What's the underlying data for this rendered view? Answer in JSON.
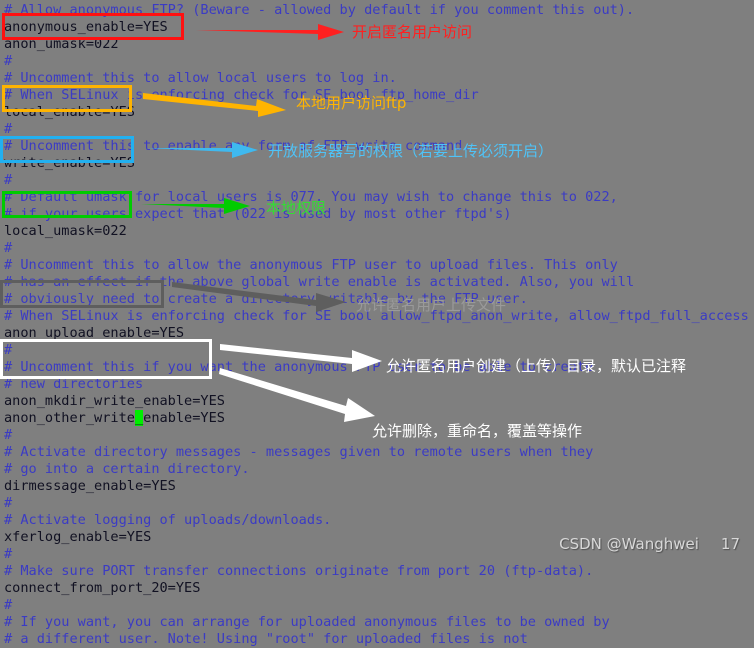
{
  "terminal": {
    "background_color": "#7f7f7f",
    "comment_color": "#3b3bc4",
    "config_color": "#111122",
    "cursor_color": "#00ee00",
    "lines": [
      {
        "t": "# Allow anonymous FTP? (Beware - allowed by default if you comment this out).",
        "k": "comment"
      },
      {
        "t": "anonymous_enable=YES",
        "k": "cfg"
      },
      {
        "t": "anon_umask=022",
        "k": "cfg"
      },
      {
        "t": "#",
        "k": "comment"
      },
      {
        "t": "# Uncomment this to allow local users to log in.",
        "k": "comment"
      },
      {
        "t": "# When SELinux is enforcing check for SE bool ftp_home_dir",
        "k": "comment"
      },
      {
        "t": "local_enable=YES",
        "k": "cfg"
      },
      {
        "t": "#",
        "k": "comment"
      },
      {
        "t": "# Uncomment this to enable any form of FTP write command.",
        "k": "comment"
      },
      {
        "t": "write_enable=YES",
        "k": "cfg"
      },
      {
        "t": "#",
        "k": "comment"
      },
      {
        "t": "# Default umask for local users is 077. You may wish to change this to 022,",
        "k": "comment"
      },
      {
        "t": "# if your users expect that (022 is used by most other ftpd's)",
        "k": "comment"
      },
      {
        "t": "local_umask=022",
        "k": "cfg"
      },
      {
        "t": "#",
        "k": "comment"
      },
      {
        "t": "# Uncomment this to allow the anonymous FTP user to upload files. This only",
        "k": "comment"
      },
      {
        "t": "# has an effect if the above global write enable is activated. Also, you will",
        "k": "comment"
      },
      {
        "t": "# obviously need to create a directory writable by the FTP user.",
        "k": "comment"
      },
      {
        "t": "# When SELinux is enforcing check for SE bool allow_ftpd_anon_write, allow_ftpd_full_access",
        "k": "comment"
      },
      {
        "t": "anon_upload_enable=YES",
        "k": "cfg"
      },
      {
        "t": "#",
        "k": "comment"
      },
      {
        "t": "# Uncomment this if you want the anonymous FTP user to be able to create",
        "k": "comment"
      },
      {
        "t": "# new directories",
        "k": "comment"
      },
      {
        "t": "anon_mkdir_write_enable=YES",
        "k": "cfg"
      },
      {
        "t": "anon_other_write_enable=YES",
        "k": "cfg",
        "cursor_index": 16
      },
      {
        "t": "#",
        "k": "comment"
      },
      {
        "t": "# Activate directory messages - messages given to remote users when they",
        "k": "comment"
      },
      {
        "t": "# go into a certain directory.",
        "k": "comment"
      },
      {
        "t": "dirmessage_enable=YES",
        "k": "cfg"
      },
      {
        "t": "#",
        "k": "comment"
      },
      {
        "t": "# Activate logging of uploads/downloads.",
        "k": "comment"
      },
      {
        "t": "xferlog_enable=YES",
        "k": "cfg"
      },
      {
        "t": "#",
        "k": "comment"
      },
      {
        "t": "# Make sure PORT transfer connections originate from port 20 (ftp-data).",
        "k": "comment"
      },
      {
        "t": "connect_from_port_20=YES",
        "k": "cfg"
      },
      {
        "t": "#",
        "k": "comment"
      },
      {
        "t": "# If you want, you can arrange for uploaded anonymous files to be owned by",
        "k": "comment"
      },
      {
        "t": "# a different user. Note! Using \"root\" for uploaded files is not",
        "k": "comment"
      }
    ]
  },
  "annotations": [
    {
      "id": "anno-anonymous",
      "label": "开启匿名用户访问",
      "color": "#ff2020",
      "box_target": "anonymous_enable=YES"
    },
    {
      "id": "anno-local",
      "label": "本地用户访问ftp",
      "color": "#ffb400",
      "box_target": "local_enable=YES"
    },
    {
      "id": "anno-write",
      "label": "开放服务器写的权限（若要上传必须开启）",
      "color": "#4fc3f7",
      "box_target": "write_enable=YES"
    },
    {
      "id": "anno-umask",
      "label": "本地权限",
      "color": "#33dd33",
      "box_target": "local_umask=022"
    },
    {
      "id": "anno-anon-upload",
      "label": "允许匿名用户上传文件",
      "color": "#9a9a9a",
      "box_target": "anon_upload_enable=YES"
    },
    {
      "id": "anno-mkdir",
      "label": "允许匿名用户创建（上传）目录，默认已注释",
      "color": "#ffffff",
      "box_target": "anon_mkdir_write_enable=YES"
    },
    {
      "id": "anno-other-write",
      "label": "允许删除，重命名，覆盖等操作",
      "color": "#ffffff",
      "box_target": "anon_other_write_enable=YES"
    }
  ],
  "watermark": {
    "source": "CSDN @Wanghwei",
    "number": "17"
  }
}
